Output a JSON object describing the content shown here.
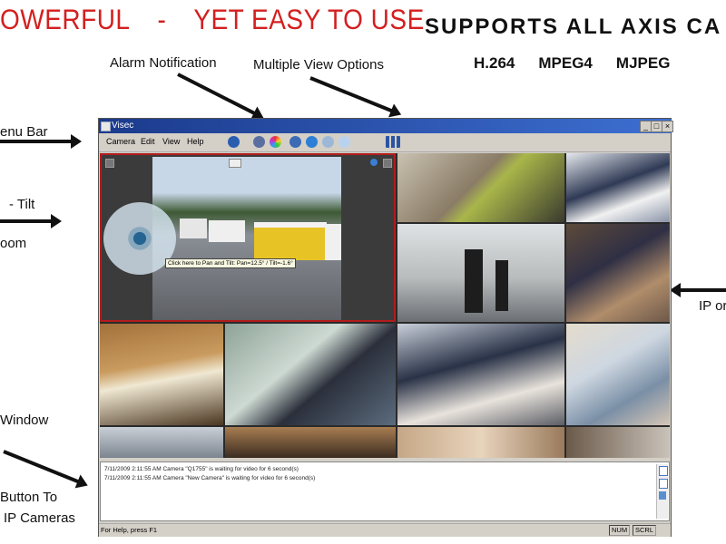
{
  "headline": {
    "left": "OWERFUL",
    "dash": "-",
    "right": "YET EASY TO USE"
  },
  "supports": "SUPPORTS ALL AXIS CA",
  "codecs": [
    "H.264",
    "MPEG4",
    "MJPEG"
  ],
  "callouts": {
    "alarm": "Alarm Notification",
    "views": "Multiple View Options",
    "menu_bar": "enu Bar",
    "pan_tilt": "- Tilt",
    "zoom": "oom",
    "window": "Window",
    "button_to": "Button To",
    "ip_cameras": "IP Cameras",
    "ip_right": "IP or"
  },
  "window": {
    "title": "Visec",
    "menus": [
      "Camera",
      "Edit",
      "View",
      "Help"
    ],
    "ptz_tooltip": "Click here to Pan and Tilt:  Pan=12.5° / Tilt=-1.6°",
    "log": [
      "7/11/2009 2:11:55 AM    Camera \"Q1755\" is waiting for video for 6 second(s)",
      "7/11/2009 2:11:55 AM    Camera \"New Camera\" is waiting for video for 6 second(s)"
    ],
    "status_help": "For Help, press F1",
    "indicators": [
      "NUM",
      "SCRL"
    ]
  },
  "colors": {
    "headline": "#d41f1f",
    "title_bar": "#1b3a8c",
    "ptz_border": "#b21c1c",
    "chrome": "#d4d0c8"
  }
}
